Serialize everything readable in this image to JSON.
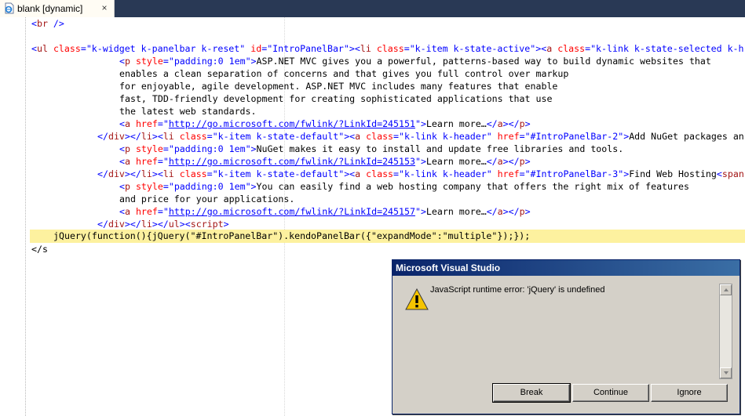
{
  "tab": {
    "label": "blank [dynamic]",
    "close_glyph": "×"
  },
  "code": {
    "line0": "<br />",
    "line2_prefix_tag": "ul",
    "line2": "<ul class=\"k-widget k-panelbar k-reset\" id=\"IntroPanelBar\"><li class=\"k-item k-state-active\"><a class=\"k-link k-state-selected k-h",
    "p1_a": "<p style=\"padding:0 1em\">ASP.NET MVC gives you a powerful, patterns-based way to build dynamic websites that",
    "p1_b": "enables a clean separation of concerns and that gives you full control over markup",
    "p1_c": "for enjoyable, agile development. ASP.NET MVC includes many features that enable",
    "p1_d": "fast, TDD-friendly development for creating sophisticated applications that use",
    "p1_e": "the latest web standards.",
    "link1_url": "http://go.microsoft.com/fwlink/?LinkId=245151",
    "learn_more": "Learn more…",
    "li2": "Add NuGet packages an",
    "p2": "NuGet makes it easy to install and update free libraries and tools.",
    "link2_url": "http://go.microsoft.com/fwlink/?LinkId=245153",
    "li3": "Find Web Hosting",
    "p3_a": "You can easily find a web hosting company that offers the right mix of features",
    "p3_b": "and price for your applications.",
    "link3_url": "http://go.microsoft.com/fwlink/?LinkId=245157",
    "js_line": "jQuery(function(){jQuery(\"#IntroPanelBar\").kendoPanelBar({\"expandMode\":\"multiple\"});});",
    "last_line": "</s"
  },
  "dialog": {
    "title": "Microsoft Visual Studio",
    "message": "JavaScript runtime error: 'jQuery' is undefined",
    "icon": "warning-icon",
    "buttons": {
      "break": "Break",
      "continue": "Continue",
      "ignore": "Ignore"
    }
  },
  "colors": {
    "tag": "#a31515",
    "attr": "#ff0000",
    "value": "#0000ff",
    "highlight": "#fdf19f",
    "titlebar": "#0a246a"
  }
}
